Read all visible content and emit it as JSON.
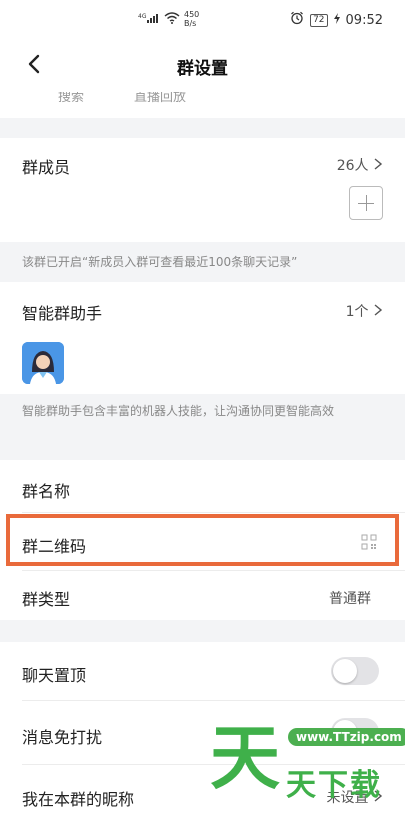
{
  "statusbar": {
    "signal": "4G",
    "net_speed_value": "450",
    "net_speed_unit": "B/s",
    "battery": "72",
    "time": "09:52",
    "icons": [
      "signal-icon",
      "wifi-icon",
      "alarm-icon",
      "battery-icon",
      "charging-icon"
    ]
  },
  "nav": {
    "title": "群设置",
    "back_icon": "chevron-left-icon"
  },
  "partial_row": {
    "left": "搜索",
    "right": "直播回放"
  },
  "members": {
    "label": "群成员",
    "count": "26人",
    "add_icon": "plus-icon"
  },
  "members_note": "该群已开启“新成员入群可查看最近100条聊天记录”",
  "assistant": {
    "label": "智能群助手",
    "count": "1个",
    "note": "智能群助手包含丰富的机器人技能，让沟通协同更智能高效"
  },
  "group_name": {
    "label": "群名称"
  },
  "qr_code": {
    "label": "群二维码",
    "icon": "qr-code-icon"
  },
  "group_type": {
    "label": "群类型",
    "value": "普通群"
  },
  "pin_chat": {
    "label": "聊天置顶",
    "on": false
  },
  "mute": {
    "label": "消息免打扰",
    "on": false
  },
  "nickname": {
    "label": "我在本群的昵称",
    "value": "未设置"
  },
  "watermark": {
    "url": "www.TTzip.com",
    "big_char": "天",
    "text": "天下载"
  },
  "colors": {
    "highlight": "#e96a3b",
    "watermark": "#3fb04a"
  }
}
